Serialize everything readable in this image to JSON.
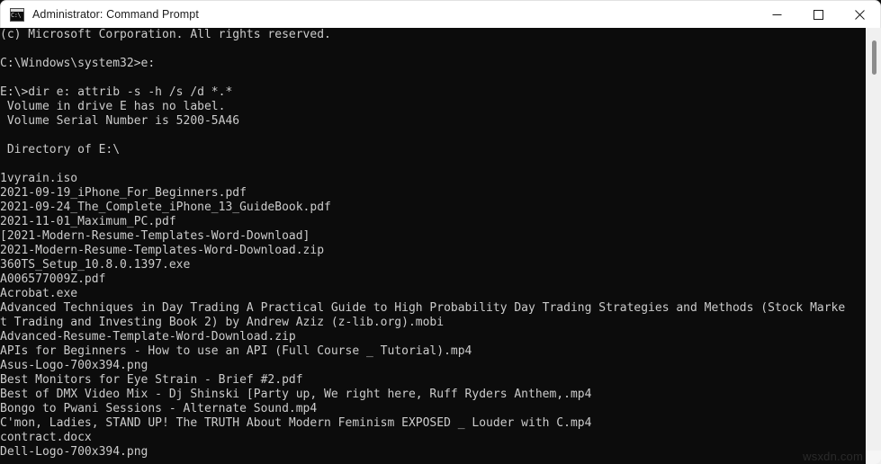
{
  "window": {
    "title": "Administrator: Command Prompt",
    "icon": "cmd-icon",
    "icon_glyph": "C:\\",
    "background_color": "#0c0c0c",
    "text_color": "#cccccc",
    "titlebar_color": "#ffffff",
    "controls": [
      {
        "name": "minimize",
        "label": "—"
      },
      {
        "name": "maximize",
        "label": "☐"
      },
      {
        "name": "close",
        "label": "✕"
      }
    ]
  },
  "scrollbar": {
    "orientation": "vertical",
    "thumb_position_percent": 3
  },
  "watermark": {
    "text": "wsxdn.com"
  },
  "console": {
    "lines": [
      "(c) Microsoft Corporation. All rights reserved.",
      "",
      "C:\\Windows\\system32>e:",
      "",
      "E:\\>dir e: attrib -s -h /s /d *.*",
      " Volume in drive E has no label.",
      " Volume Serial Number is 5200-5A46",
      "",
      " Directory of E:\\",
      "",
      "1vyrain.iso",
      "2021-09-19_iPhone_For_Beginners.pdf",
      "2021-09-24_The_Complete_iPhone_13_GuideBook.pdf",
      "2021-11-01_Maximum_PC.pdf",
      "[2021-Modern-Resume-Templates-Word-Download]",
      "2021-Modern-Resume-Templates-Word-Download.zip",
      "360TS_Setup_10.8.0.1397.exe",
      "A006577009Z.pdf",
      "Acrobat.exe",
      "Advanced Techniques in Day Trading A Practical Guide to High Probability Day Trading Strategies and Methods (Stock Market Trading and Investing Book 2) by Andrew Aziz (z-lib.org).mobi",
      "Advanced-Resume-Template-Word-Download.zip",
      "APIs for Beginners - How to use an API (Full Course _ Tutorial).mp4",
      "Asus-Logo-700x394.png",
      "Best Monitors for Eye Strain - Brief #2.pdf",
      "Best of DMX Video Mix - Dj Shinski [Party up, We right here, Ruff Ryders Anthem,.mp4",
      "Bongo to Pwani Sessions - Alternate Sound.mp4",
      "C'mon, Ladies, STAND UP! The TRUTH About Modern Feminism EXPOSED _ Louder with C.mp4",
      "contract.docx",
      "Dell-Logo-700x394.png"
    ]
  }
}
